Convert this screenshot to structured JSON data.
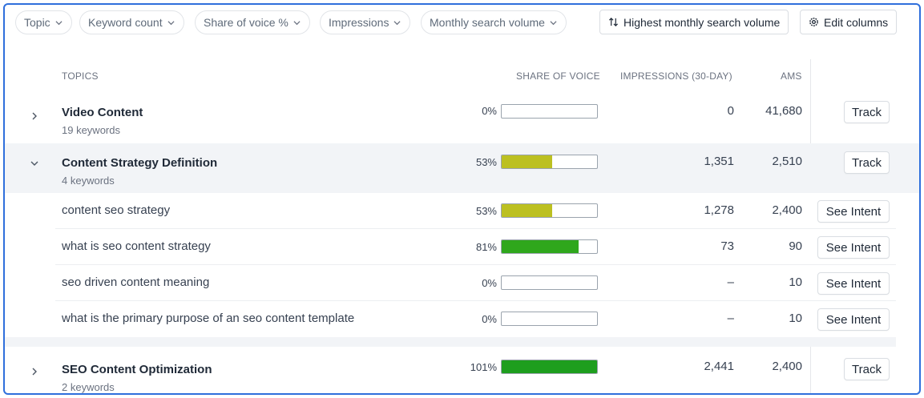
{
  "filters": [
    {
      "label": "Topic"
    },
    {
      "label": "Keyword count"
    },
    {
      "label": "Share of voice %"
    },
    {
      "label": "Impressions"
    },
    {
      "label": "Monthly search volume"
    }
  ],
  "toolbar": {
    "sort_label": "Highest monthly search volume",
    "edit_columns_label": "Edit columns"
  },
  "table": {
    "headers": {
      "topics": "TOPICS",
      "share_of_voice": "SHARE OF VOICE",
      "impressions": "IMPRESSIONS (30-DAY)",
      "ams": "AMS"
    },
    "groups": [
      {
        "title": "Video Content",
        "sublabel": "19 keywords",
        "expanded": false,
        "sov_label": "0%",
        "sov_value": 0,
        "impressions": "0",
        "ams": "41,680",
        "action": "Track"
      },
      {
        "title": "Content Strategy Definition",
        "sublabel": "4 keywords",
        "expanded": true,
        "sov_label": "53%",
        "sov_value": 53,
        "impressions": "1,351",
        "ams": "2,510",
        "action": "Track",
        "keywords": [
          {
            "keyword": "content seo strategy",
            "sov_label": "53%",
            "sov_value": 53,
            "impressions": "1,278",
            "ams": "2,400",
            "action": "See Intent"
          },
          {
            "keyword": "what is seo content strategy",
            "sov_label": "81%",
            "sov_value": 81,
            "impressions": "73",
            "ams": "90",
            "action": "See Intent"
          },
          {
            "keyword": "seo driven content meaning",
            "sov_label": "0%",
            "sov_value": 0,
            "impressions": "–",
            "ams": "10",
            "action": "See Intent"
          },
          {
            "keyword": "what is the primary purpose of an seo content template",
            "sov_label": "0%",
            "sov_value": 0,
            "impressions": "–",
            "ams": "10",
            "action": "See Intent"
          }
        ]
      },
      {
        "title": "SEO Content Optimization",
        "sublabel": "2 keywords",
        "expanded": false,
        "sov_label": "101%",
        "sov_value": 101,
        "impressions": "2,441",
        "ams": "2,400",
        "action": "Track"
      }
    ]
  },
  "colors": {
    "frame_border": "#2f6fdc",
    "sov_mid": "#bcc021",
    "sov_high": "#2fa71c",
    "sov_full": "#1e9e1e",
    "expanded_row_bg": "#f2f4f7"
  }
}
